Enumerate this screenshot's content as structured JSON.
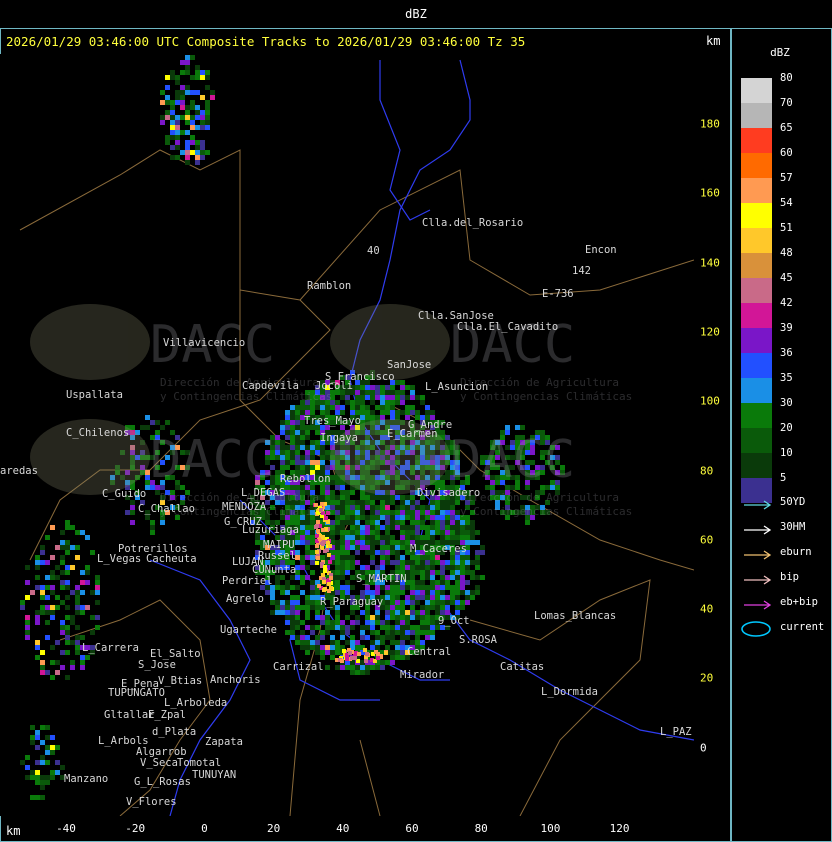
{
  "window_title": "dBZ",
  "header": "2026/01/29 03:46:00 UTC Composite Tracks to 2026/01/29 03:46:00 Tz 35",
  "units": {
    "km_top": "km",
    "km_bottom": "km"
  },
  "x_ticks": [
    "-40",
    "-20",
    "0",
    "20",
    "40",
    "60",
    "80",
    "100",
    "120"
  ],
  "y_ticks": [
    "180",
    "160",
    "140",
    "120",
    "100",
    "80",
    "60",
    "40",
    "20",
    "0"
  ],
  "legend": {
    "title": "dBZ",
    "levels": [
      {
        "label": "80",
        "color": "#d4d4d4"
      },
      {
        "label": "70",
        "color": "#b6b6b6"
      },
      {
        "label": "65",
        "color": "#ff3c20"
      },
      {
        "label": "60",
        "color": "#ff6a00"
      },
      {
        "label": "57",
        "color": "#ff9a52"
      },
      {
        "label": "54",
        "color": "#ffff00"
      },
      {
        "label": "51",
        "color": "#ffc82a"
      },
      {
        "label": "48",
        "color": "#d9913a"
      },
      {
        "label": "45",
        "color": "#c96a88"
      },
      {
        "label": "42",
        "color": "#d21697"
      },
      {
        "label": "39",
        "color": "#7a16c8"
      },
      {
        "label": "36",
        "color": "#2250ff"
      },
      {
        "label": "35",
        "color": "#1a8fe6"
      },
      {
        "label": "30",
        "color": "#0a7a0a"
      },
      {
        "label": "20",
        "color": "#0a5a0a"
      },
      {
        "label": "10",
        "color": "#0a3a0a"
      },
      {
        "label": "5",
        "color": "#3b3090"
      }
    ],
    "tracks": [
      {
        "label": "50YD",
        "color": "#5fd8e0"
      },
      {
        "label": "30HM",
        "color": "#ffffff"
      },
      {
        "label": "eburn",
        "color": "#f0c070"
      },
      {
        "label": "bip",
        "color": "#f0c0c0"
      },
      {
        "label": "eb+bip",
        "color": "#e040e0"
      },
      {
        "label": "current",
        "color": "#00c8ff"
      }
    ]
  },
  "watermark": {
    "brand": "DACC",
    "line1": "Dirección de Agricultura",
    "line2": "y Contingencias Climáticas"
  },
  "places": [
    {
      "name": "Clla.del_Rosario",
      "x": 422,
      "y": 226
    },
    {
      "name": "Encon",
      "x": 585,
      "y": 253
    },
    {
      "name": "142",
      "x": 572,
      "y": 274
    },
    {
      "name": "E_1-736",
      "x": 542,
      "y": 297
    },
    {
      "name": "Ramblon",
      "x": 307,
      "y": 289
    },
    {
      "name": "40",
      "x": 367,
      "y": 254
    },
    {
      "name": "Clla.SanJose",
      "x": 418,
      "y": 319
    },
    {
      "name": "Clla.El_Cavadito",
      "x": 457,
      "y": 330
    },
    {
      "name": "Villavicencio",
      "x": 163,
      "y": 346
    },
    {
      "name": "S_Francisco",
      "x": 325,
      "y": 380
    },
    {
      "name": "SanJose",
      "x": 387,
      "y": 368
    },
    {
      "name": "Capdevila",
      "x": 242,
      "y": 389
    },
    {
      "name": "Jocoli",
      "x": 315,
      "y": 389
    },
    {
      "name": "L_Asuncion",
      "x": 425,
      "y": 390
    },
    {
      "name": "Uspallata",
      "x": 66,
      "y": 398
    },
    {
      "name": "Tres_Mayo",
      "x": 304,
      "y": 424
    },
    {
      "name": "G_Andre",
      "x": 408,
      "y": 428
    },
    {
      "name": "C_Chilenos",
      "x": 66,
      "y": 436
    },
    {
      "name": "Ingaya",
      "x": 320,
      "y": 441
    },
    {
      "name": "E_Carmen",
      "x": 387,
      "y": 437
    },
    {
      "name": "aredas",
      "x": 0,
      "y": 474
    },
    {
      "name": "Rebollon",
      "x": 280,
      "y": 482
    },
    {
      "name": "L_DEGAS",
      "x": 241,
      "y": 496
    },
    {
      "name": "Divisadero",
      "x": 417,
      "y": 496
    },
    {
      "name": "C_Guido",
      "x": 102,
      "y": 497
    },
    {
      "name": "C_Challao",
      "x": 138,
      "y": 512
    },
    {
      "name": "MENDOZA",
      "x": 222,
      "y": 510
    },
    {
      "name": "G_CRUZ",
      "x": 224,
      "y": 525
    },
    {
      "name": "Luzuriaga",
      "x": 242,
      "y": 533
    },
    {
      "name": "MAIPU",
      "x": 263,
      "y": 548
    },
    {
      "name": "Potrerillos",
      "x": 118,
      "y": 552
    },
    {
      "name": "M_Caceres",
      "x": 410,
      "y": 552
    },
    {
      "name": "Russel",
      "x": 258,
      "y": 559
    },
    {
      "name": "L_Vegas",
      "x": 97,
      "y": 562
    },
    {
      "name": "Cacheuta",
      "x": 146,
      "y": 562
    },
    {
      "name": "LUJAN",
      "x": 232,
      "y": 565
    },
    {
      "name": "CUNunta",
      "x": 252,
      "y": 573
    },
    {
      "name": "Perdriel",
      "x": 222,
      "y": 584
    },
    {
      "name": "S_MARTIN",
      "x": 356,
      "y": 582
    },
    {
      "name": "Agrelo",
      "x": 226,
      "y": 602
    },
    {
      "name": "R_Paraguay",
      "x": 320,
      "y": 605
    },
    {
      "name": "L_Carrera_1",
      "x": 82,
      "y": 651
    },
    {
      "name": "Lomas_Blancas",
      "x": 534,
      "y": 619
    },
    {
      "name": "9_Oct",
      "x": 438,
      "y": 624
    },
    {
      "name": "S.ROSA",
      "x": 459,
      "y": 643
    },
    {
      "name": "Ugarteche",
      "x": 220,
      "y": 633
    },
    {
      "name": "Central",
      "x": 407,
      "y": 655
    },
    {
      "name": "Carrizal",
      "x": 273,
      "y": 670
    },
    {
      "name": "S_Jose",
      "x": 138,
      "y": 668
    },
    {
      "name": "El_Salto",
      "x": 150,
      "y": 657
    },
    {
      "name": "Catitas",
      "x": 500,
      "y": 670
    },
    {
      "name": "Mirador",
      "x": 400,
      "y": 678
    },
    {
      "name": "Anchoris",
      "x": 210,
      "y": 683
    },
    {
      "name": "V_Btias",
      "x": 158,
      "y": 684
    },
    {
      "name": "E_Pena",
      "x": 121,
      "y": 687
    },
    {
      "name": "TUPUNGATO",
      "x": 108,
      "y": 696
    },
    {
      "name": "L_Dormida",
      "x": 541,
      "y": 695
    },
    {
      "name": "L_Arboleda",
      "x": 164,
      "y": 706
    },
    {
      "name": "Gltallar",
      "x": 104,
      "y": 718
    },
    {
      "name": "E_Zpal",
      "x": 148,
      "y": 718
    },
    {
      "name": "d_Plata",
      "x": 152,
      "y": 735
    },
    {
      "name": "L_PAZ",
      "x": 660,
      "y": 735
    },
    {
      "name": "L_Arbols",
      "x": 98,
      "y": 744
    },
    {
      "name": "Zapata",
      "x": 205,
      "y": 745
    },
    {
      "name": "Algarrob",
      "x": 136,
      "y": 755
    },
    {
      "name": "V_Seca",
      "x": 140,
      "y": 766
    },
    {
      "name": "Tomotal",
      "x": 177,
      "y": 766
    },
    {
      "name": "TUNUYAN",
      "x": 192,
      "y": 778
    },
    {
      "name": "Manzano",
      "x": 64,
      "y": 782
    },
    {
      "name": "G_L_Rosas",
      "x": 134,
      "y": 785
    },
    {
      "name": "V_Flores",
      "x": 126,
      "y": 805
    }
  ]
}
